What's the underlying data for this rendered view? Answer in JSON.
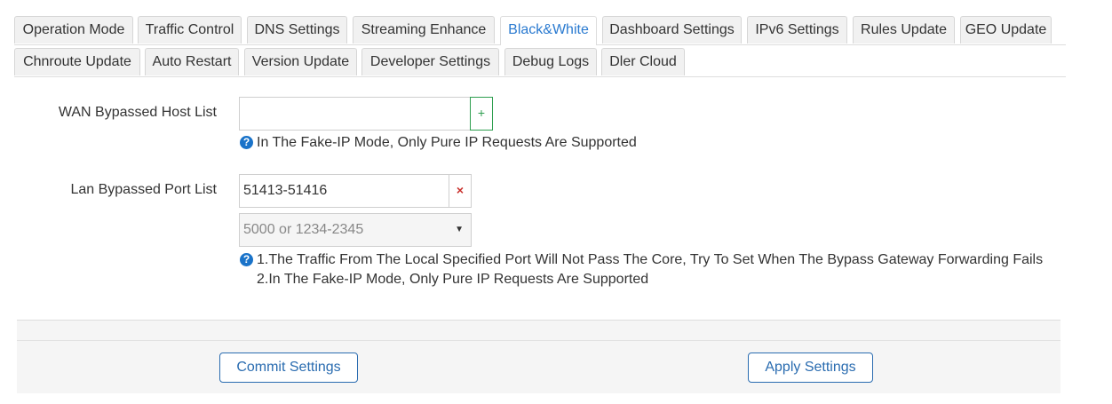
{
  "tabs_row1": [
    {
      "label": "Operation Mode",
      "active": false
    },
    {
      "label": "Traffic Control",
      "active": false
    },
    {
      "label": "DNS Settings",
      "active": false
    },
    {
      "label": "Streaming Enhance",
      "active": false
    },
    {
      "label": "Black&White",
      "active": true
    },
    {
      "label": "Dashboard Settings",
      "active": false
    },
    {
      "label": "IPv6 Settings",
      "active": false
    },
    {
      "label": "Rules Update",
      "active": false
    },
    {
      "label": "GEO Update",
      "active": false
    }
  ],
  "tabs_row2": [
    {
      "label": "Chnroute Update",
      "active": false
    },
    {
      "label": "Auto Restart",
      "active": false
    },
    {
      "label": "Version Update",
      "active": false
    },
    {
      "label": "Developer Settings",
      "active": false
    },
    {
      "label": "Debug Logs",
      "active": false
    },
    {
      "label": "Dler Cloud",
      "active": false
    }
  ],
  "wan": {
    "label": "WAN Bypassed Host List",
    "value": "",
    "add_symbol": "+",
    "help_icon": "?",
    "help": "In The Fake-IP Mode, Only Pure IP Requests Are Supported"
  },
  "lan": {
    "label": "Lan Bypassed Port List",
    "value": "51413-51416",
    "remove_symbol": "×",
    "select_placeholder": "5000 or 1234-2345",
    "help_icon": "?",
    "help_line1": "1.The Traffic From The Local Specified Port Will Not Pass The Core, Try To Set When The Bypass Gateway Forwarding Fails",
    "help_line2": "2.In The Fake-IP Mode, Only Pure IP Requests Are Supported"
  },
  "buttons": {
    "commit": "Commit Settings",
    "apply": "Apply Settings"
  },
  "colors": {
    "accent": "#2a7ad0",
    "add": "#2e9e4f",
    "remove": "#c9302c"
  }
}
